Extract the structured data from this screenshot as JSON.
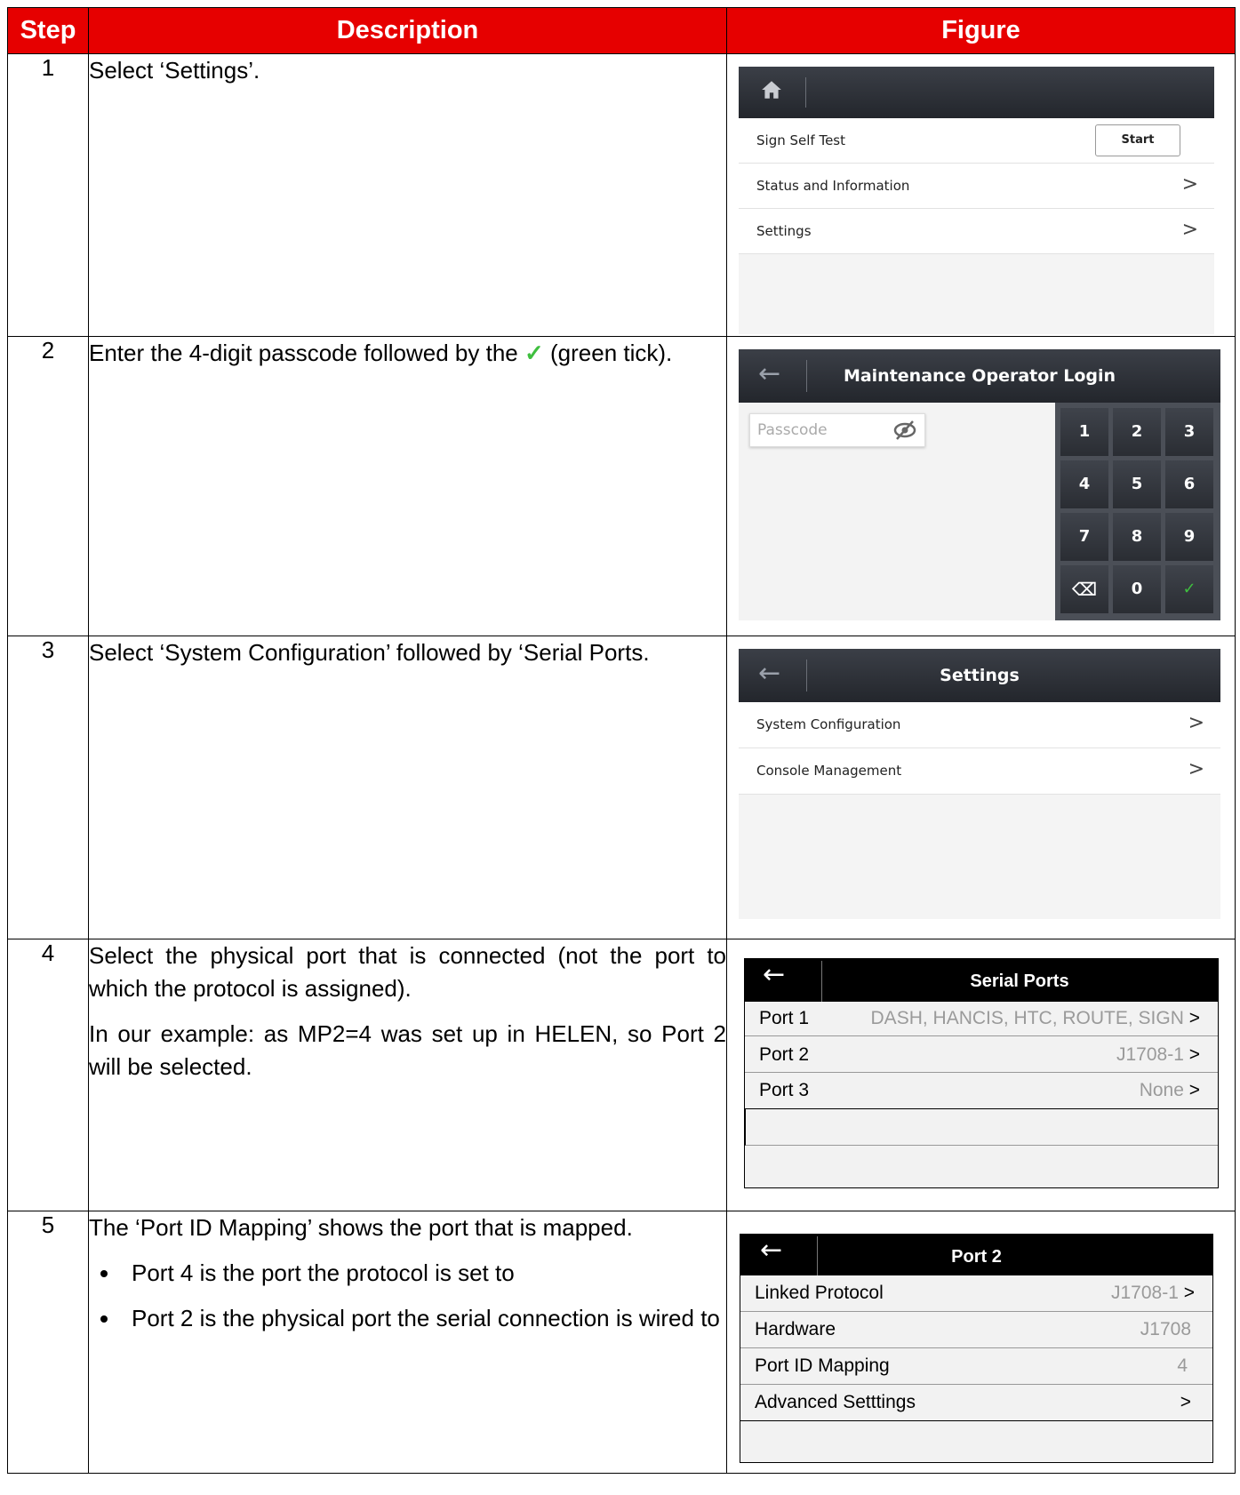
{
  "table": {
    "headers": [
      "Step",
      "Description",
      "Figure"
    ],
    "rows": [
      {
        "step": "1",
        "desc": "Select ‘Settings’."
      },
      {
        "step": "2",
        "desc_a": "Enter the 4-digit passcode followed by the",
        "tick": "✓",
        "desc_b": "(green tick)."
      },
      {
        "step": "3",
        "desc": "Select ‘System Configuration’ followed by ‘Serial Ports."
      },
      {
        "step": "4",
        "desc_p1": "Select the physical port that is connected (not the port to which the protocol is assigned).",
        "desc_p2": "In our example: as MP2=4 was set up in HELEN, so Port 2 will be selected."
      },
      {
        "step": "5",
        "desc_p1": "The ‘Port ID Mapping’ shows the port that is mapped.",
        "bullets": [
          "Port 4 is the port the protocol is set to",
          "Port 2 is the physical port the serial connection is wired to"
        ]
      }
    ]
  },
  "fig1": {
    "rows": [
      {
        "label": "Sign Self Test",
        "button": "Start"
      },
      {
        "label": "Status and Information",
        "chevron": ">"
      },
      {
        "label": "Settings",
        "chevron": ">"
      }
    ]
  },
  "fig2": {
    "title": "Maintenance Operator Login",
    "placeholder": "Passcode",
    "keys": [
      "1",
      "2",
      "3",
      "4",
      "5",
      "6",
      "7",
      "8",
      "9",
      "⌫",
      "0",
      "✓"
    ]
  },
  "fig3": {
    "title": "Settings",
    "rows": [
      {
        "label": "System Configuration",
        "chevron": ">"
      },
      {
        "label": "Console Management",
        "chevron": ">"
      }
    ]
  },
  "fig4": {
    "title": "Serial Ports",
    "rows": [
      {
        "label": "Port 1",
        "value": "DASH, HANCIS, HTC, ROUTE, SIGN",
        "chevron": ">"
      },
      {
        "label": "Port 2",
        "value": "J1708-1",
        "chevron": ">"
      },
      {
        "label": "Port 3",
        "value": "None",
        "chevron": ">"
      }
    ]
  },
  "fig5": {
    "title": "Port 2",
    "rows": [
      {
        "label": "Linked Protocol",
        "value": "J1708-1",
        "chevron": ">"
      },
      {
        "label": "Hardware",
        "value": "J1708"
      },
      {
        "label": "Port ID Mapping",
        "value": "4"
      },
      {
        "label": "Advanced Setttings",
        "chevron": ">"
      }
    ]
  },
  "colors": {
    "header_red": "#e60000",
    "tick_green": "#3fbf3f"
  }
}
